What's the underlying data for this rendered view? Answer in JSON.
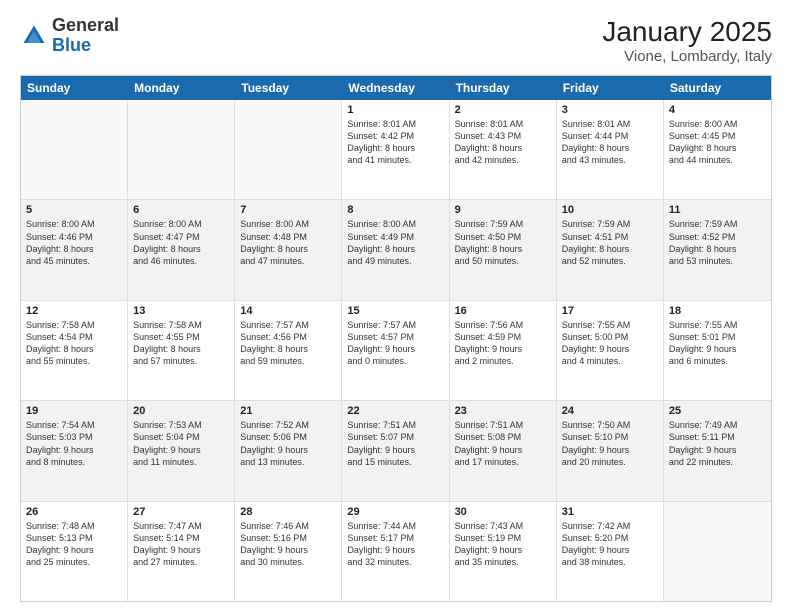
{
  "logo": {
    "general": "General",
    "blue": "Blue"
  },
  "title": "January 2025",
  "subtitle": "Vione, Lombardy, Italy",
  "days": [
    "Sunday",
    "Monday",
    "Tuesday",
    "Wednesday",
    "Thursday",
    "Friday",
    "Saturday"
  ],
  "weeks": [
    [
      {
        "day": "",
        "info": ""
      },
      {
        "day": "",
        "info": ""
      },
      {
        "day": "",
        "info": ""
      },
      {
        "day": "1",
        "info": "Sunrise: 8:01 AM\nSunset: 4:42 PM\nDaylight: 8 hours\nand 41 minutes."
      },
      {
        "day": "2",
        "info": "Sunrise: 8:01 AM\nSunset: 4:43 PM\nDaylight: 8 hours\nand 42 minutes."
      },
      {
        "day": "3",
        "info": "Sunrise: 8:01 AM\nSunset: 4:44 PM\nDaylight: 8 hours\nand 43 minutes."
      },
      {
        "day": "4",
        "info": "Sunrise: 8:00 AM\nSunset: 4:45 PM\nDaylight: 8 hours\nand 44 minutes."
      }
    ],
    [
      {
        "day": "5",
        "info": "Sunrise: 8:00 AM\nSunset: 4:46 PM\nDaylight: 8 hours\nand 45 minutes."
      },
      {
        "day": "6",
        "info": "Sunrise: 8:00 AM\nSunset: 4:47 PM\nDaylight: 8 hours\nand 46 minutes."
      },
      {
        "day": "7",
        "info": "Sunrise: 8:00 AM\nSunset: 4:48 PM\nDaylight: 8 hours\nand 47 minutes."
      },
      {
        "day": "8",
        "info": "Sunrise: 8:00 AM\nSunset: 4:49 PM\nDaylight: 8 hours\nand 49 minutes."
      },
      {
        "day": "9",
        "info": "Sunrise: 7:59 AM\nSunset: 4:50 PM\nDaylight: 8 hours\nand 50 minutes."
      },
      {
        "day": "10",
        "info": "Sunrise: 7:59 AM\nSunset: 4:51 PM\nDaylight: 8 hours\nand 52 minutes."
      },
      {
        "day": "11",
        "info": "Sunrise: 7:59 AM\nSunset: 4:52 PM\nDaylight: 8 hours\nand 53 minutes."
      }
    ],
    [
      {
        "day": "12",
        "info": "Sunrise: 7:58 AM\nSunset: 4:54 PM\nDaylight: 8 hours\nand 55 minutes."
      },
      {
        "day": "13",
        "info": "Sunrise: 7:58 AM\nSunset: 4:55 PM\nDaylight: 8 hours\nand 57 minutes."
      },
      {
        "day": "14",
        "info": "Sunrise: 7:57 AM\nSunset: 4:56 PM\nDaylight: 8 hours\nand 59 minutes."
      },
      {
        "day": "15",
        "info": "Sunrise: 7:57 AM\nSunset: 4:57 PM\nDaylight: 9 hours\nand 0 minutes."
      },
      {
        "day": "16",
        "info": "Sunrise: 7:56 AM\nSunset: 4:59 PM\nDaylight: 9 hours\nand 2 minutes."
      },
      {
        "day": "17",
        "info": "Sunrise: 7:55 AM\nSunset: 5:00 PM\nDaylight: 9 hours\nand 4 minutes."
      },
      {
        "day": "18",
        "info": "Sunrise: 7:55 AM\nSunset: 5:01 PM\nDaylight: 9 hours\nand 6 minutes."
      }
    ],
    [
      {
        "day": "19",
        "info": "Sunrise: 7:54 AM\nSunset: 5:03 PM\nDaylight: 9 hours\nand 8 minutes."
      },
      {
        "day": "20",
        "info": "Sunrise: 7:53 AM\nSunset: 5:04 PM\nDaylight: 9 hours\nand 11 minutes."
      },
      {
        "day": "21",
        "info": "Sunrise: 7:52 AM\nSunset: 5:06 PM\nDaylight: 9 hours\nand 13 minutes."
      },
      {
        "day": "22",
        "info": "Sunrise: 7:51 AM\nSunset: 5:07 PM\nDaylight: 9 hours\nand 15 minutes."
      },
      {
        "day": "23",
        "info": "Sunrise: 7:51 AM\nSunset: 5:08 PM\nDaylight: 9 hours\nand 17 minutes."
      },
      {
        "day": "24",
        "info": "Sunrise: 7:50 AM\nSunset: 5:10 PM\nDaylight: 9 hours\nand 20 minutes."
      },
      {
        "day": "25",
        "info": "Sunrise: 7:49 AM\nSunset: 5:11 PM\nDaylight: 9 hours\nand 22 minutes."
      }
    ],
    [
      {
        "day": "26",
        "info": "Sunrise: 7:48 AM\nSunset: 5:13 PM\nDaylight: 9 hours\nand 25 minutes."
      },
      {
        "day": "27",
        "info": "Sunrise: 7:47 AM\nSunset: 5:14 PM\nDaylight: 9 hours\nand 27 minutes."
      },
      {
        "day": "28",
        "info": "Sunrise: 7:46 AM\nSunset: 5:16 PM\nDaylight: 9 hours\nand 30 minutes."
      },
      {
        "day": "29",
        "info": "Sunrise: 7:44 AM\nSunset: 5:17 PM\nDaylight: 9 hours\nand 32 minutes."
      },
      {
        "day": "30",
        "info": "Sunrise: 7:43 AM\nSunset: 5:19 PM\nDaylight: 9 hours\nand 35 minutes."
      },
      {
        "day": "31",
        "info": "Sunrise: 7:42 AM\nSunset: 5:20 PM\nDaylight: 9 hours\nand 38 minutes."
      },
      {
        "day": "",
        "info": ""
      }
    ]
  ]
}
